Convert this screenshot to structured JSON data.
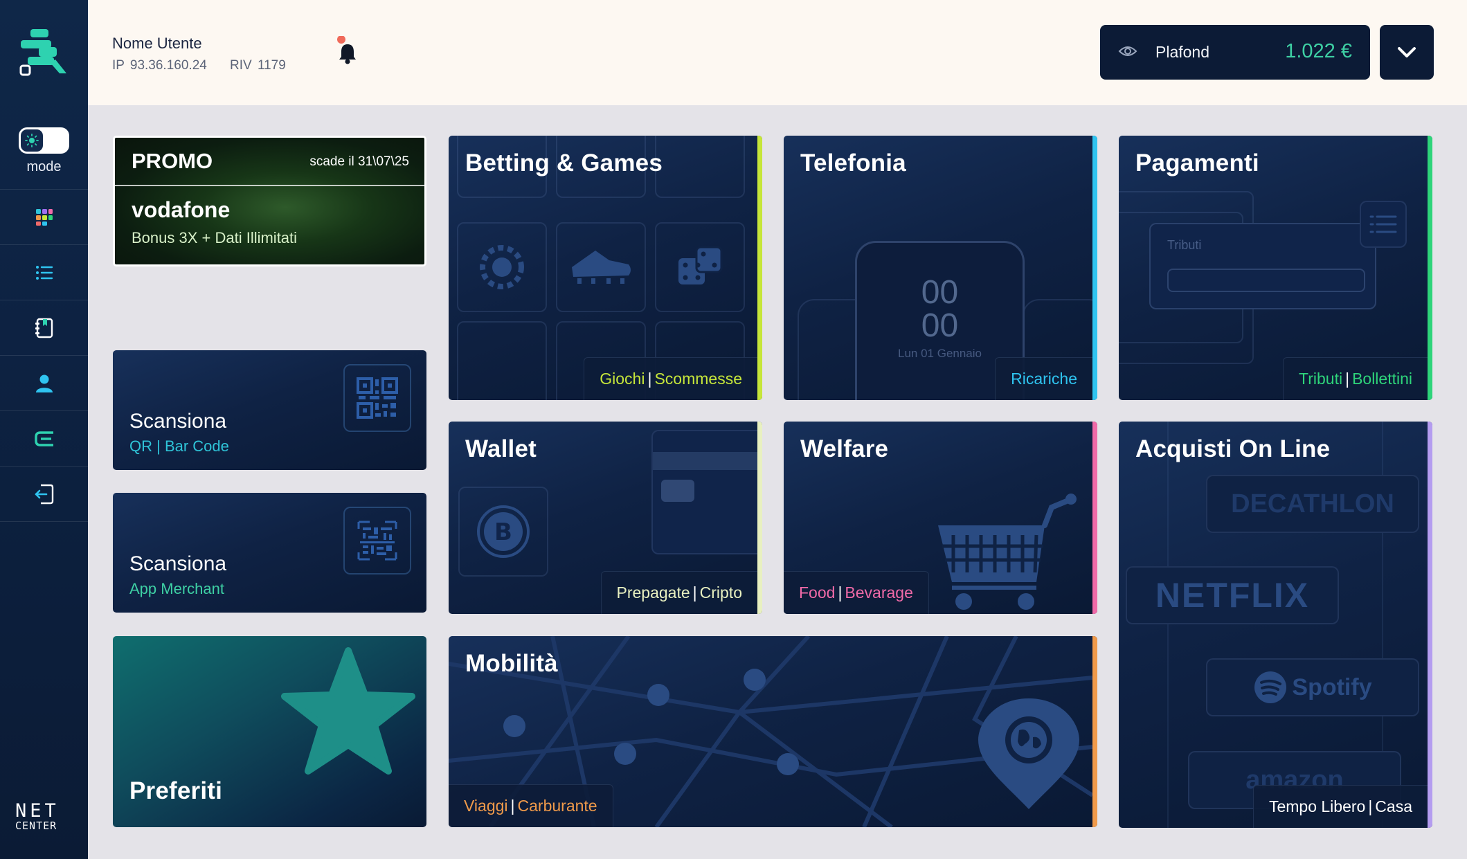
{
  "sidebar": {
    "mode_label": "mode",
    "nav": [
      {
        "name": "nav-dashboard",
        "icon": "grid-icon"
      },
      {
        "name": "nav-list",
        "icon": "list-icon"
      },
      {
        "name": "nav-book",
        "icon": "book-icon"
      },
      {
        "name": "nav-profile",
        "icon": "user-icon"
      },
      {
        "name": "nav-brand",
        "icon": "brand-e-icon"
      },
      {
        "name": "nav-logout",
        "icon": "logout-icon"
      }
    ],
    "footer_brand_line1": "NET",
    "footer_brand_line2": "CENTER"
  },
  "header": {
    "user_name": "Nome Utente",
    "ip_label": "IP",
    "ip_value": "93.36.160.24",
    "riv_label": "RIV",
    "riv_value": "1179",
    "plafond_label": "Plafond",
    "plafond_value": "1.022  €"
  },
  "promo": {
    "title": "PROMO",
    "expiry": "scade il 31\\07\\25",
    "brand": "vodafone",
    "bonus": "Bonus 3X + Dati Illimitati"
  },
  "scan_qr": {
    "title": "Scansiona",
    "subtitle": "QR | Bar Code"
  },
  "scan_merchant": {
    "title": "Scansiona",
    "subtitle": "App Merchant"
  },
  "favorites": {
    "title": "Preferiti"
  },
  "tiles": {
    "betting": {
      "title": "Betting & Games",
      "tag1": "Giochi",
      "tag2": "Scommesse",
      "accent": "#c6e63a"
    },
    "telefonia": {
      "title": "Telefonia",
      "tag1": "Ricariche",
      "accent": "#2fc4f0",
      "phone_time_h": "00",
      "phone_time_m": "00",
      "phone_date": "Lun 01 Gennaio"
    },
    "pagamenti": {
      "title": "Pagamenti",
      "tag1": "Tributi",
      "tag2": "Bollettini",
      "accent": "#2ed47a",
      "form_label": "Tributi"
    },
    "wallet": {
      "title": "Wallet",
      "tag1": "Prepagate",
      "tag2": "Cripto",
      "accent": "#e8f0c0"
    },
    "welfare": {
      "title": "Welfare",
      "tag1": "Food",
      "tag2": "Bevarage",
      "accent": "#f06aa8"
    },
    "acquisti": {
      "title": "Acquisti On Line",
      "tag1": "Tempo Libero",
      "tag2": "Casa",
      "accent": "#b49cf0",
      "brands": [
        "DECATHLON",
        "NETFLIX",
        "Spotify",
        "amazon"
      ]
    },
    "mobilita": {
      "title": "Mobilità",
      "tag1": "Viaggi",
      "tag2": "Carburante",
      "accent": "#f09a4a"
    }
  }
}
